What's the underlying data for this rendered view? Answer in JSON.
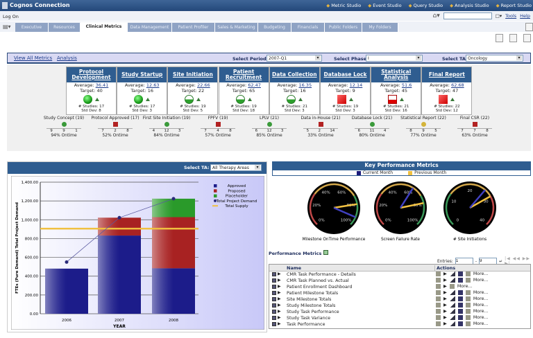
{
  "app": {
    "title": "Cognos Connection",
    "log_on": "Log On",
    "studios": [
      "Metric Studio",
      "Event Studio",
      "Query Studio",
      "Analysis Studio",
      "Report Studio"
    ],
    "tools": "Tools",
    "help": "Help"
  },
  "tabs": [
    {
      "label": "Executive",
      "active": false
    },
    {
      "label": "Resources",
      "active": false
    },
    {
      "label": "Clinical Metrics",
      "active": true
    },
    {
      "label": "Data Management",
      "active": false
    },
    {
      "label": "Patient Profiler",
      "active": false
    },
    {
      "label": "Sales & Marketing",
      "active": false
    },
    {
      "label": "Budgeting",
      "active": false
    },
    {
      "label": "Financials",
      "active": false
    },
    {
      "label": "Public Folders",
      "active": false
    },
    {
      "label": "My Folders",
      "active": false
    }
  ],
  "filters": {
    "view_all": "View All Metrics",
    "analysis": "Analysis",
    "period_label": "Select Period:",
    "period": "2007-Q1",
    "phase_label": "Select Phase:",
    "phase": "I",
    "ta_label": "Select TA:",
    "ta": "Oncology"
  },
  "cards": [
    {
      "title": "Protocol Development",
      "average": "36.41",
      "target": "Target: 40",
      "studies": "# Studies: 17",
      "std": "Std Dev: 8",
      "status": "green"
    },
    {
      "title": "Study Startup",
      "average": "12.63",
      "target": "Target: 16",
      "studies": "# Studies: 17",
      "std": "Std Dev: 3",
      "status": "green"
    },
    {
      "title": "Site Initiation",
      "average": "22.66",
      "target": "Target: 22",
      "studies": "# Studies: 19",
      "std": "Std Dev: 5",
      "status": "half"
    },
    {
      "title": "Patient Recruitment",
      "average": "62.47",
      "target": "Target: 65",
      "studies": "# Studies: 19",
      "std": "Std Dev: 18",
      "status": "half"
    },
    {
      "title": "Data Collection",
      "average": "16.35",
      "target": "Target: 16",
      "studies": "# Studies: 21",
      "std": "Std Dev: 3",
      "status": "half"
    },
    {
      "title": "Database Lock",
      "average": "12.14",
      "target": "Target: 9",
      "studies": "# Studies: 19",
      "std": "Std Dev: 3",
      "status": "red"
    },
    {
      "title": "Statistical Analysis",
      "average": "51.6",
      "target": "Target: 45",
      "studies": "# Studies: 21",
      "std": "Std Dev: 16",
      "status": "halfred"
    },
    {
      "title": "Final Report",
      "average": "62.68",
      "target": "Target: 47",
      "studies": "# Studies: 22",
      "std": "Std Dev: 12",
      "status": "red"
    }
  ],
  "average_label": "Average:",
  "milestones": [
    {
      "label": "Study Concept (19)",
      "nums": [
        "9",
        "9",
        "1"
      ],
      "ontime": "94% Ontime",
      "status": "#3a9a3a"
    },
    {
      "label": "Protocol Approved (17)",
      "nums": [
        "7",
        "2",
        "8"
      ],
      "ontime": "52% Ontime",
      "status": "#b22222"
    },
    {
      "label": "First Site Initiation (19)",
      "nums": [
        "4",
        "12",
        "3"
      ],
      "ontime": "84% Ontime",
      "status": "#3a9a3a"
    },
    {
      "label": "FPFV (19)",
      "nums": [
        "7",
        "4",
        "8"
      ],
      "ontime": "57% Ontime",
      "status": "#b22222"
    },
    {
      "label": "LPLV (21)",
      "nums": [
        "6",
        "12",
        "3"
      ],
      "ontime": "85% Ontime",
      "status": "#3a9a3a"
    },
    {
      "label": "Data in-House (21)",
      "nums": [
        "5",
        "2",
        "14"
      ],
      "ontime": "33% Ontime",
      "status": "#b22222"
    },
    {
      "label": "Database Lock (21)",
      "nums": [
        "6",
        "11",
        "4"
      ],
      "ontime": "80% Ontime",
      "status": "#3a9a3a"
    },
    {
      "label": "Statistical Report (22)",
      "nums": [
        "8",
        "9",
        "5"
      ],
      "ontime": "77% Ontime",
      "status": "#d4b43a"
    },
    {
      "label": "Final CSR (22)",
      "nums": [
        "7",
        "7",
        "8"
      ],
      "ontime": "63% Ontime",
      "status": "#b22222"
    }
  ],
  "resource": {
    "ta_label": "Select TA:",
    "ta": "All Therapy Areas"
  },
  "chart_data": {
    "type": "bar",
    "categories": [
      "2006",
      "2007",
      "2008"
    ],
    "series": [
      {
        "name": "Approved",
        "values": [
          480,
          832,
          484
        ],
        "color": "#1c1c8a"
      },
      {
        "name": "Proposed",
        "values": [
          0,
          190,
          544
        ],
        "color": "#a82222"
      },
      {
        "name": "Placeholder",
        "values": [
          0,
          0,
          196
        ],
        "color": "#2a9a2a"
      }
    ],
    "lines": [
      {
        "name": "Total Project Demand",
        "values": [
          550,
          1022,
          1224
        ],
        "color": "#2a2a7a"
      },
      {
        "name": "Total Supply",
        "values": [
          905,
          905,
          905
        ],
        "color": "#f0c040"
      }
    ],
    "xlabel": "YEAR",
    "ylabel": "FTEs (Pure Demand) Total Project Demand",
    "ylim": [
      0,
      1400
    ],
    "yticks": [
      "0.00",
      "200.00",
      "400.00",
      "600.00",
      "800.00",
      "1,000.00",
      "1,200.00",
      "1,400.00"
    ],
    "legend": "top-right",
    "grid": true
  },
  "kpi": {
    "title": "Key Performance Metrics",
    "current": "Current Month",
    "previous": "Previous Month",
    "current_color": "#1a1a7a",
    "previous_color": "#f0c040",
    "gauges": [
      {
        "label": "Milestone OnTime Performance",
        "max": 100,
        "ticks": [
          "0%",
          "20%",
          "40%",
          "60%",
          "80%",
          "100%"
        ],
        "current": 92,
        "previous": 80,
        "bands": [
          "#c04848",
          "#d4a84a",
          "#3a9a5a"
        ]
      },
      {
        "label": "Screen Failure Rate",
        "max": 100,
        "ticks": [
          "0%",
          "20%",
          "40%",
          "60%",
          "80%",
          "100%"
        ],
        "current": 62,
        "previous": 79,
        "bands": [
          "#c04848",
          "#d4a84a",
          "#3a9a5a"
        ]
      },
      {
        "label": "# Site Initiations",
        "max": 40,
        "ticks": [
          "0",
          "10",
          "20",
          "30",
          "40"
        ],
        "current": 26,
        "previous": 29,
        "bands": [
          "#3a9a5a",
          "#d4a84a",
          "#c04848"
        ]
      }
    ]
  },
  "perf": {
    "title": "Performance Metrics",
    "entries_label": "Entries:",
    "from": "1",
    "to": "9",
    "col_name": "Name",
    "col_actions": "Actions",
    "more": "More...",
    "rows": [
      "CMR Task Performance - Details",
      "CMR Task Planned vs. Actual",
      "Patient Enrollment Dashboard",
      "Patient Milestone Totals",
      "Site Milestone Totals",
      "Study Milestone Totals",
      "Study Task Performance",
      "Study Task Variance",
      "Task Performance"
    ]
  }
}
